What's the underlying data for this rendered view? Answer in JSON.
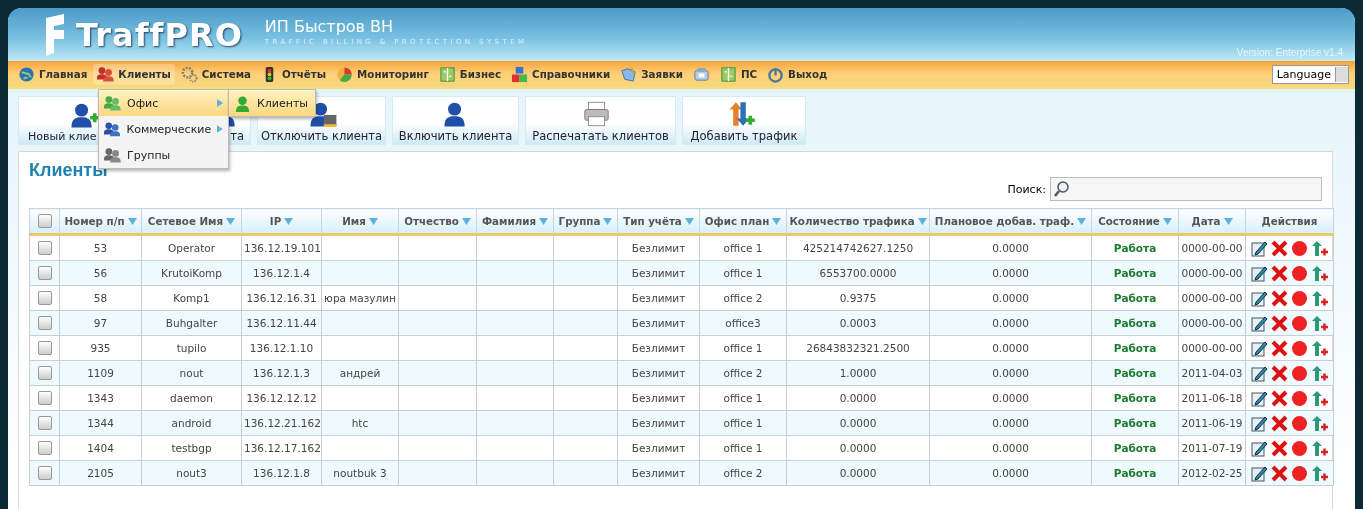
{
  "header": {
    "logo": "TraffPRO",
    "company": "ИП Быстров ВН",
    "tagline": "TRAFFIC BILLING & PROTECTION SYSTEM",
    "version": "Version: Enterprise v1.4"
  },
  "nav": [
    {
      "kind": "link",
      "label": "Главная",
      "selected": false
    },
    {
      "kind": "link",
      "label": "Клиенты",
      "selected": true
    },
    {
      "kind": "link",
      "label": "Система",
      "selected": false
    },
    {
      "kind": "link",
      "label": "Отчёты",
      "selected": false
    },
    {
      "kind": "link",
      "label": "Мониторинг",
      "selected": false
    },
    {
      "kind": "link",
      "label": "Бизнес",
      "selected": false
    },
    {
      "kind": "link",
      "label": "Справочники",
      "selected": false
    },
    {
      "kind": "link",
      "label": "Заявки",
      "selected": false
    },
    {
      "kind": "icon",
      "selected": false
    },
    {
      "kind": "link",
      "label": "ПС",
      "selected": false
    },
    {
      "kind": "link",
      "label": "Выход",
      "selected": false
    }
  ],
  "language": {
    "value": "Language"
  },
  "dropdown": {
    "items": [
      {
        "label": "Офис",
        "submenu": true,
        "selected": true
      },
      {
        "label": "Коммерческие",
        "submenu": true,
        "selected": false
      },
      {
        "label": "Группы",
        "submenu": false,
        "selected": false
      }
    ],
    "submenu": [
      {
        "label": "Клиенты",
        "selected": true
      }
    ]
  },
  "toolbar": [
    {
      "label": "Новый клие"
    },
    {
      "label": "та"
    },
    {
      "label": "Отключить клиента"
    },
    {
      "label": "Включить клиента"
    },
    {
      "label": "Распечатать клиентов"
    },
    {
      "label": "Добавить трафик"
    }
  ],
  "page_title": "Клиенты",
  "search": {
    "label": "Поиск:"
  },
  "table": {
    "select_all": {
      "checked": false
    },
    "columns": [
      {
        "label": "Номер п/п",
        "sortable": true
      },
      {
        "label": "Сетевое Имя",
        "sortable": true
      },
      {
        "label": "IP",
        "sortable": true
      },
      {
        "label": "Имя",
        "sortable": true
      },
      {
        "label": "Отчество",
        "sortable": true
      },
      {
        "label": "Фамилия",
        "sortable": true
      },
      {
        "label": "Группа",
        "sortable": true
      },
      {
        "label": "Тип учёта",
        "sortable": true
      },
      {
        "label": "Офис план",
        "sortable": true
      },
      {
        "label": "Количество трафика",
        "sortable": true
      },
      {
        "label": "Плановое добав. траф.",
        "sortable": true
      },
      {
        "label": "Состояние",
        "sortable": true
      },
      {
        "label": "Дата",
        "sortable": true
      },
      {
        "label": "Действия",
        "sortable": false
      }
    ],
    "rows": [
      {
        "checked": false,
        "cells": [
          "53",
          "Operator",
          "136.12.19.101",
          "",
          "",
          "",
          "",
          "Безлимит",
          "office 1",
          "425214742627.1250",
          "0.0000",
          "Работа",
          "0000-00-00"
        ]
      },
      {
        "checked": false,
        "cells": [
          "56",
          "KrutoiKomp",
          "136.12.1.4",
          "",
          "",
          "",
          "",
          "Безлимит",
          "office 1",
          "6553700.0000",
          "0.0000",
          "Работа",
          "0000-00-00"
        ]
      },
      {
        "checked": false,
        "cells": [
          "58",
          "Komp1",
          "136.12.16.31",
          "юра мазулин",
          "",
          "",
          "",
          "Безлимит",
          "office 2",
          "0.9375",
          "0.0000",
          "Работа",
          "0000-00-00"
        ]
      },
      {
        "checked": false,
        "cells": [
          "97",
          "Buhgalter",
          "136.12.11.44",
          "",
          "",
          "",
          "",
          "Безлимит",
          "office3",
          "0.0003",
          "0.0000",
          "Работа",
          "0000-00-00"
        ]
      },
      {
        "checked": false,
        "cells": [
          "935",
          "tupilo",
          "136.12.1.10",
          "",
          "",
          "",
          "",
          "Безлимит",
          "office 1",
          "26843832321.2500",
          "0.0000",
          "Работа",
          "0000-00-00"
        ]
      },
      {
        "checked": false,
        "cells": [
          "1109",
          "nout",
          "136.12.1.3",
          "андрей",
          "",
          "",
          "",
          "Безлимит",
          "office 2",
          "1.0000",
          "0.0000",
          "Работа",
          "2011-04-03"
        ]
      },
      {
        "checked": false,
        "cells": [
          "1343",
          "daemon",
          "136.12.12.12",
          "",
          "",
          "",
          "",
          "Безлимит",
          "office 1",
          "0.0000",
          "0.0000",
          "Работа",
          "2011-06-18"
        ]
      },
      {
        "checked": false,
        "cells": [
          "1344",
          "android",
          "136.12.21.162",
          "htc",
          "",
          "",
          "",
          "Безлимит",
          "office 1",
          "0.0000",
          "0.0000",
          "Работа",
          "2011-06-19"
        ]
      },
      {
        "checked": false,
        "cells": [
          "1404",
          "testbgp",
          "136.12.17.162",
          "",
          "",
          "",
          "",
          "Безлимит",
          "office 1",
          "0.0000",
          "0.0000",
          "Работа",
          "2011-07-19"
        ]
      },
      {
        "checked": false,
        "cells": [
          "2105",
          "nout3",
          "136.12.1.8",
          "noutbuk 3",
          "",
          "",
          "",
          "Безлимит",
          "office 2",
          "0.0000",
          "0.0000",
          "Работа",
          "2012-02-25"
        ]
      }
    ]
  }
}
